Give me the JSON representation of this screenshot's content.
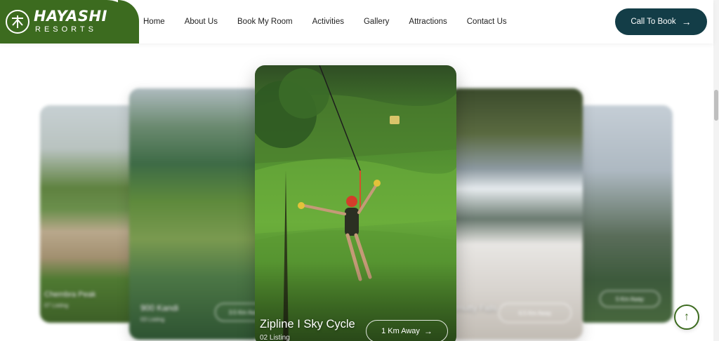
{
  "brand": {
    "name": "HAYASHI",
    "sub": "RESORTS",
    "color": "#3c6b1f"
  },
  "nav": {
    "items": [
      "Home",
      "About Us",
      "Book My Room",
      "Activities",
      "Gallery",
      "Attractions",
      "Contact Us"
    ]
  },
  "cta": {
    "label": "Call To Book",
    "icon": "arrow-right-icon",
    "color": "#133d47"
  },
  "carousel": {
    "cards": [
      {
        "title": "Chembra Peak",
        "sub": "07 Listing",
        "distance": ""
      },
      {
        "title": "900 Kandi",
        "sub": "03 Listing",
        "distance": "3.5 Km Away"
      },
      {
        "title": "Zipline I Sky Cycle",
        "sub": "02 Listing",
        "distance": "1 Km Away"
      },
      {
        "title": "Meenmutty Falls",
        "sub": "",
        "distance": "6.5 Km Away"
      },
      {
        "title": "",
        "sub": "",
        "distance": "5 Km Away"
      }
    ]
  },
  "back_to_top": {
    "icon": "arrow-up-icon"
  }
}
